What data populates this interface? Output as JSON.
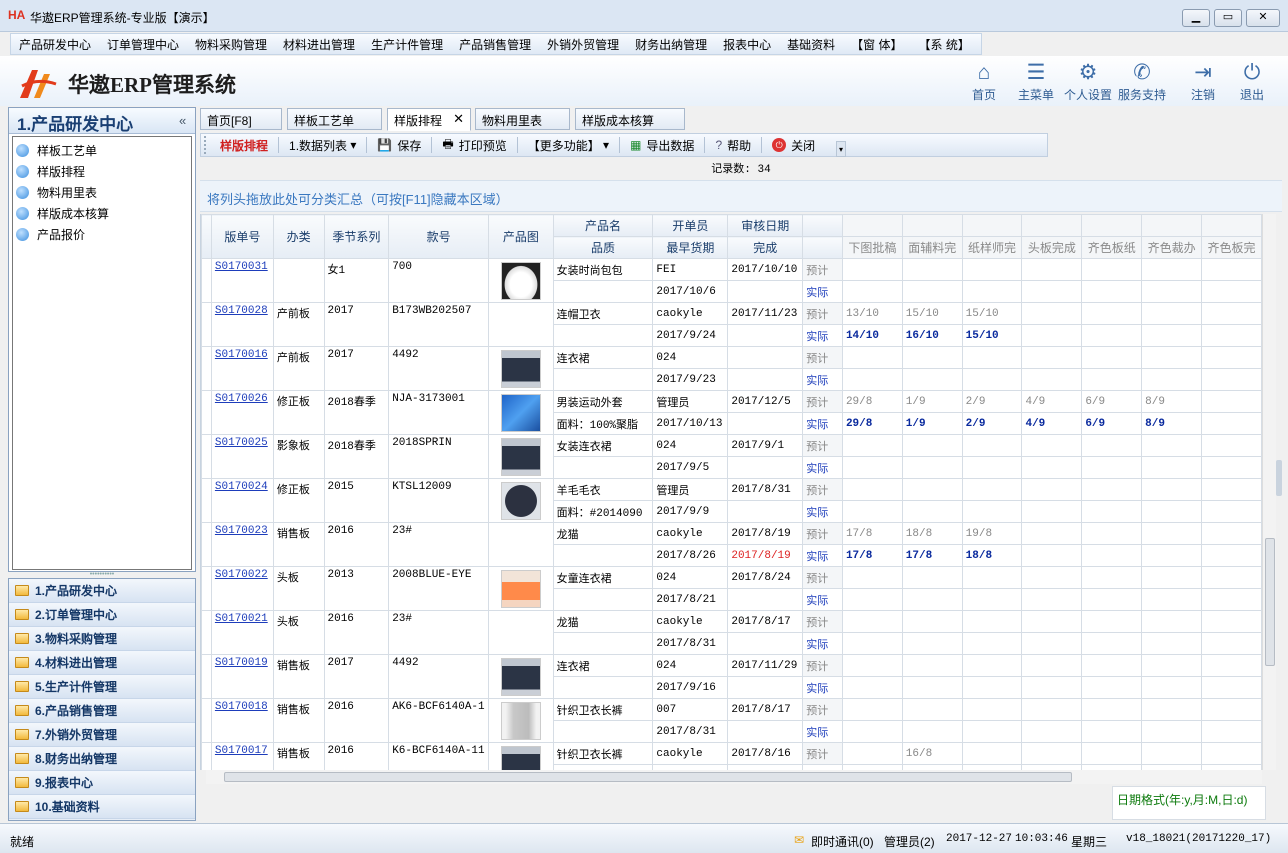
{
  "window": {
    "title": "华遨ERP管理系统-专业版【演示】",
    "logo": "HA",
    "buttons": [
      "minimize",
      "maximize",
      "close"
    ]
  },
  "menu": [
    "产品研发中心",
    "订单管理中心",
    "物料采购管理",
    "材料进出管理",
    "生产计件管理",
    "产品销售管理",
    "外销外贸管理",
    "财务出纳管理",
    "报表中心",
    "基础资料",
    "【窗 体】",
    "【系 统】"
  ],
  "banner": {
    "title": "华遨ERP管理系统",
    "actions": [
      {
        "label": "首页",
        "icon": "home-icon"
      },
      {
        "label": "主菜单",
        "icon": "list-icon"
      },
      {
        "label": "个人设置",
        "icon": "gear-icon"
      },
      {
        "label": "服务支持",
        "icon": "support-icon"
      },
      {
        "label": "注销",
        "icon": "logout-icon"
      },
      {
        "label": "退出",
        "icon": "power-icon"
      }
    ]
  },
  "left": {
    "title": "1.产品研发中心",
    "collapse": "«",
    "items": [
      "样板工艺单",
      "样版排程",
      "物料用里表",
      "样版成本核算",
      "产品报价"
    ]
  },
  "modules": [
    "1.产品研发中心",
    "2.订单管理中心",
    "3.物料采购管理",
    "4.材料进出管理",
    "5.生产计件管理",
    "6.产品销售管理",
    "7.外销外贸管理",
    "8.财务出纳管理",
    "9.报表中心",
    "10.基础资料"
  ],
  "tabs": [
    {
      "label": "首页[F8]"
    },
    {
      "label": "样板工艺单"
    },
    {
      "label": "样版排程",
      "close": "✕"
    },
    {
      "label": "物料用里表"
    },
    {
      "label": "样版成本核算"
    }
  ],
  "toolbar": {
    "title": "样版排程",
    "list": "1.数据列表",
    "save": "保存",
    "print": "打印预览",
    "more": "【更多功能】",
    "export": "导出数据",
    "help": "帮助",
    "close": "关闭"
  },
  "record_count": "记录数: 34",
  "group_hint": "将列头拖放此处可分类汇总（可按[F11]隐藏本区域）",
  "grid": {
    "headers": {
      "num": "版单号",
      "type": "办类",
      "season": "季节系列",
      "style": "款号",
      "img": "产品图",
      "name": "产品名",
      "quality": "品质",
      "opener": "开单员",
      "earliest": "最早货期",
      "audit": "审核日期",
      "done": "完成",
      "s1": "下图批稿",
      "s2": "面辅料完",
      "s3": "纸样师完",
      "s4": "头板完成",
      "s5": "齐色板纸",
      "s6": "齐色裁办",
      "s7": "齐色板完"
    },
    "plan": "预计",
    "actual": "实际",
    "rows": [
      {
        "num": "S0170031",
        "type": "",
        "season": "女1",
        "style": "700",
        "img": "white-bag",
        "name": "女装时尚包包",
        "quality": "",
        "opener": "FEI",
        "earliest": "2017/10/6",
        "audit": "2017/10/10",
        "plan": [
          "",
          "",
          "",
          "",
          "",
          "",
          ""
        ],
        "act": [
          "",
          "",
          "",
          "",
          "",
          "",
          ""
        ]
      },
      {
        "num": "S0170028",
        "type": "产前板",
        "season": "2017",
        "style": "B173WB202507",
        "img": "",
        "name": "连帽卫衣",
        "quality": "",
        "opener": "caokyle",
        "earliest": "2017/9/24",
        "audit": "2017/11/23",
        "plan": [
          "13/10",
          "15/10",
          "15/10",
          "",
          "",
          "",
          ""
        ],
        "act": [
          "14/10",
          "16/10",
          "15/10",
          "",
          "",
          "",
          ""
        ]
      },
      {
        "num": "S0170016",
        "type": "产前板",
        "season": "2017",
        "style": "4492",
        "img": "dress",
        "name": "连衣裙",
        "quality": "",
        "opener": "024",
        "earliest": "2017/9/23",
        "audit": "",
        "plan": [
          "",
          "",
          "",
          "",
          "",
          "",
          ""
        ],
        "act": [
          "",
          "",
          "",
          "",
          "",
          "",
          ""
        ]
      },
      {
        "num": "S0170026",
        "type": "修正板",
        "season": "2018春季",
        "style": "NJA-3173001",
        "img": "jacket",
        "name": "男装运动外套",
        "quality": "面料：100%聚脂",
        "opener": "管理员",
        "earliest": "2017/10/13",
        "audit": "2017/12/5",
        "plan": [
          "29/8",
          "1/9",
          "2/9",
          "4/9",
          "6/9",
          "8/9",
          ""
        ],
        "act": [
          "29/8",
          "1/9",
          "2/9",
          "4/9",
          "6/9",
          "8/9",
          ""
        ]
      },
      {
        "num": "S0170025",
        "type": "影象板",
        "season": "2018春季",
        "style": "2018SPRIN",
        "img": "dress",
        "name": "女装连衣裙",
        "quality": "",
        "opener": "024",
        "earliest": "2017/9/5",
        "audit": "2017/9/1",
        "plan": [
          "",
          "",
          "",
          "",
          "",
          "",
          ""
        ],
        "act": [
          "",
          "",
          "",
          "",
          "",
          "",
          ""
        ]
      },
      {
        "num": "S0170024",
        "type": "修正板",
        "season": "2015",
        "style": "KTSL12009",
        "img": "sweater",
        "name": "羊毛毛衣",
        "quality": "面料：#2014090",
        "opener": "管理员",
        "earliest": "2017/9/9",
        "audit": "2017/8/31",
        "plan": [
          "",
          "",
          "",
          "",
          "",
          "",
          ""
        ],
        "act": [
          "",
          "",
          "",
          "",
          "",
          "",
          ""
        ]
      },
      {
        "num": "S0170023",
        "type": "销售板",
        "season": "2016",
        "style": "23#",
        "img": "",
        "name": "龙猫",
        "quality": "",
        "opener": "caokyle",
        "earliest": "2017/8/26",
        "audit": "2017/8/19",
        "done": "2017/8/19",
        "plan": [
          "17/8",
          "18/8",
          "19/8",
          "",
          "",
          "",
          ""
        ],
        "act": [
          "17/8",
          "17/8",
          "18/8",
          "",
          "",
          "",
          ""
        ]
      },
      {
        "num": "S0170022",
        "type": "头板",
        "season": "2013",
        "style": "2008BLUE-EYE",
        "img": "girl",
        "name": "女童连衣裙",
        "quality": "",
        "opener": "024",
        "earliest": "2017/8/21",
        "audit": "2017/8/24",
        "plan": [
          "",
          "",
          "",
          "",
          "",
          "",
          ""
        ],
        "act": [
          "",
          "",
          "",
          "",
          "",
          "",
          ""
        ]
      },
      {
        "num": "S0170021",
        "type": "头板",
        "season": "2016",
        "style": "23#",
        "img": "",
        "name": "龙猫",
        "quality": "",
        "opener": "caokyle",
        "earliest": "2017/8/31",
        "audit": "2017/8/17",
        "plan": [
          "",
          "",
          "",
          "",
          "",
          "",
          ""
        ],
        "act": [
          "",
          "",
          "",
          "",
          "",
          "",
          ""
        ]
      },
      {
        "num": "S0170019",
        "type": "销售板",
        "season": "2017",
        "style": "4492",
        "img": "dress",
        "name": "连衣裙",
        "quality": "",
        "opener": "024",
        "earliest": "2017/9/16",
        "audit": "2017/11/29",
        "plan": [
          "",
          "",
          "",
          "",
          "",
          "",
          ""
        ],
        "act": [
          "",
          "",
          "",
          "",
          "",
          "",
          ""
        ]
      },
      {
        "num": "S0170018",
        "type": "销售板",
        "season": "2016",
        "style": "AK6-BCF6140A-1",
        "img": "pants",
        "name": "针织卫衣长裤",
        "quality": "",
        "opener": "007",
        "earliest": "2017/8/31",
        "audit": "2017/8/17",
        "plan": [
          "",
          "",
          "",
          "",
          "",
          "",
          ""
        ],
        "act": [
          "",
          "",
          "",
          "",
          "",
          "",
          ""
        ]
      },
      {
        "num": "S0170017",
        "type": "销售板",
        "season": "2016",
        "style": "K6-BCF6140A-11",
        "img": "dress",
        "name": "针织卫衣长裤",
        "quality": "",
        "opener": "caokyle",
        "earliest": "",
        "audit": "2017/8/16",
        "plan": [
          "",
          "16/8",
          "",
          "",
          "",
          "",
          ""
        ],
        "act": [
          "",
          "",
          "",
          "",
          "",
          "",
          ""
        ]
      }
    ]
  },
  "date_format": "日期格式(年:y,月:M,日:d)",
  "status": {
    "left": "就绪",
    "im": "即时通讯(0)",
    "user": "管理员(2)",
    "date": "2017-12-27",
    "time": "10:03:46",
    "weekday": "星期三",
    "version": "v18_18021(20171220_17)"
  }
}
